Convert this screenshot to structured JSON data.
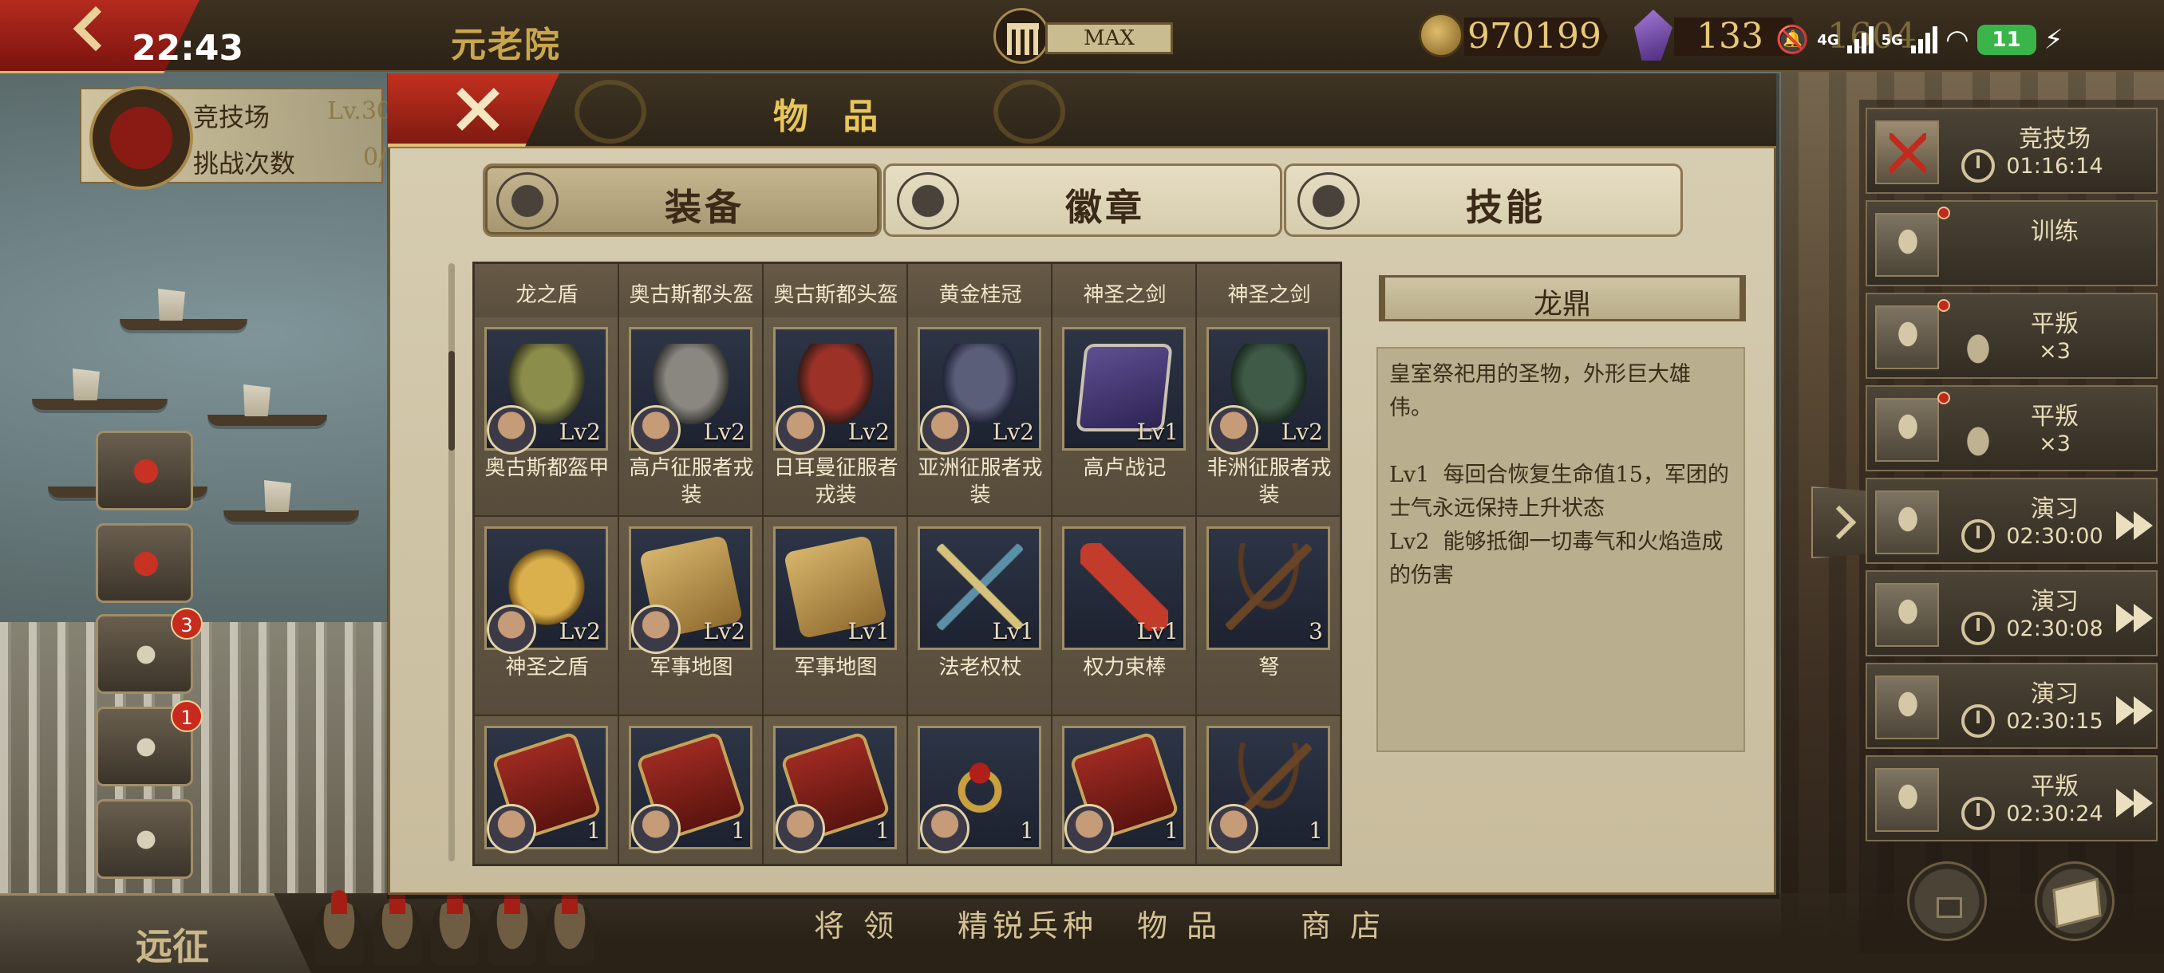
{
  "status_bar": {
    "time": "22:43",
    "network_a": "4G",
    "network_b": "5G",
    "battery": "11"
  },
  "top_bar": {
    "location": "元老院",
    "building_level": "MAX",
    "coins": "970199",
    "gems": "133",
    "obscured_value": "1604"
  },
  "left_panel": {
    "arena_title": "竞技场",
    "arena_level": "Lv.30",
    "challenge_label": "挑战次数",
    "challenge_count": "0/",
    "video_badge": "3",
    "chest_badge": "1"
  },
  "bottom_bar": {
    "expedition": "远征",
    "tabs": [
      "将 领",
      "精锐兵种",
      "物 品",
      "商 店"
    ]
  },
  "queue": [
    {
      "label": "竞技场",
      "time": "01:16:14",
      "icon": "crossed-swords-icon",
      "dot": false,
      "timer": true,
      "ff": false
    },
    {
      "label": "训练",
      "time": "",
      "icon": "helmet-icon",
      "dot": true,
      "timer": false,
      "ff": false
    },
    {
      "label": "平叛",
      "time": "×3",
      "icon": "gladiator-helmet-icon",
      "dot": true,
      "timer": false,
      "ff": false
    },
    {
      "label": "平叛",
      "time": "×3",
      "icon": "gladiator-helmet-icon",
      "dot": true,
      "timer": false,
      "ff": false
    },
    {
      "label": "演习",
      "time": "02:30:00",
      "icon": "drill-icon",
      "dot": false,
      "timer": true,
      "ff": true
    },
    {
      "label": "演习",
      "time": "02:30:08",
      "icon": "drill-icon",
      "dot": false,
      "timer": true,
      "ff": true
    },
    {
      "label": "演习",
      "time": "02:30:15",
      "icon": "drill-icon",
      "dot": false,
      "timer": true,
      "ff": true
    },
    {
      "label": "平叛",
      "time": "02:30:24",
      "icon": "gladiator-helmet-icon",
      "dot": false,
      "timer": true,
      "ff": true
    }
  ],
  "modal": {
    "title": "物 品",
    "tabs": [
      {
        "label": "装备",
        "icon": "equipment-icon"
      },
      {
        "label": "徽章",
        "icon": "badge-icon"
      },
      {
        "label": "技能",
        "icon": "scroll-icon"
      }
    ],
    "items": [
      {
        "name": "龙之盾",
        "level": "",
        "art": "",
        "avatar": false,
        "top": true
      },
      {
        "name": "奥古斯都头盔",
        "level": "",
        "art": "",
        "avatar": false,
        "top": true
      },
      {
        "name": "奥古斯都头盔",
        "level": "",
        "art": "",
        "avatar": false,
        "top": true
      },
      {
        "name": "黄金桂冠",
        "level": "",
        "art": "",
        "avatar": false,
        "top": true
      },
      {
        "name": "神圣之剑",
        "level": "",
        "art": "",
        "avatar": false,
        "top": true
      },
      {
        "name": "神圣之剑",
        "level": "",
        "art": "",
        "avatar": false,
        "top": true
      },
      {
        "name": "奥古斯都盔甲",
        "level": "Lv2",
        "art": "armor-green",
        "avatar": true
      },
      {
        "name": "高卢征服者戎装",
        "level": "Lv2",
        "art": "armor-gray",
        "avatar": true
      },
      {
        "name": "日耳曼征服者戎装",
        "level": "Lv2",
        "art": "armor-red",
        "avatar": true
      },
      {
        "name": "亚洲征服者戎装",
        "level": "Lv2",
        "art": "armor-navy",
        "avatar": true
      },
      {
        "name": "高卢战记",
        "level": "Lv1",
        "art": "book",
        "avatar": false
      },
      {
        "name": "非洲征服者戎装",
        "level": "Lv2",
        "art": "armor-dkgreen",
        "avatar": true
      },
      {
        "name": "神圣之盾",
        "level": "Lv2",
        "art": "shield-gold",
        "avatar": true
      },
      {
        "name": "军事地图",
        "level": "Lv2",
        "art": "map",
        "avatar": true
      },
      {
        "name": "军事地图",
        "level": "Lv1",
        "art": "map",
        "avatar": false
      },
      {
        "name": "法老权杖",
        "level": "Lv1",
        "art": "staff",
        "avatar": false
      },
      {
        "name": "权力束棒",
        "level": "Lv1",
        "art": "fasces",
        "avatar": false
      },
      {
        "name": "弩",
        "level": "3",
        "art": "crossbow",
        "avatar": false
      },
      {
        "name": "",
        "level": "1",
        "art": "scutum",
        "avatar": true
      },
      {
        "name": "",
        "level": "1",
        "art": "scutum",
        "avatar": true
      },
      {
        "name": "",
        "level": "1",
        "art": "scutum",
        "avatar": true
      },
      {
        "name": "",
        "level": "1",
        "art": "ring",
        "avatar": true
      },
      {
        "name": "",
        "level": "1",
        "art": "scutum",
        "avatar": true
      },
      {
        "name": "",
        "level": "1",
        "art": "crossbow",
        "avatar": true
      }
    ],
    "detail": {
      "title": "龙鼎",
      "desc": "皇室祭祀用的圣物，外形巨大雄伟。",
      "lv1": "Lv1  每回合恢复生命值15，军团的士气永远保持上升状态",
      "lv2": "Lv2  能够抵御一切毒气和火焰造成的伤害"
    }
  }
}
